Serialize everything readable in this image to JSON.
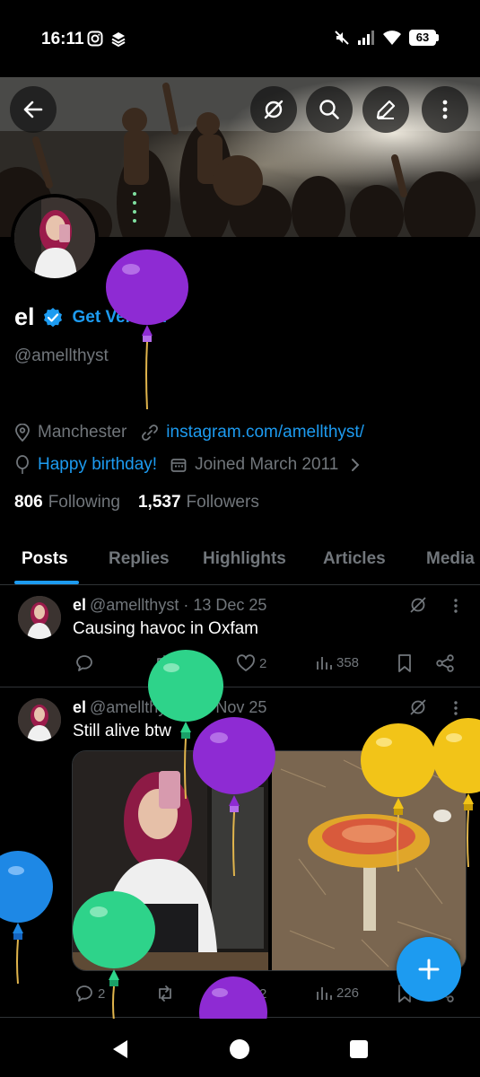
{
  "status_bar": {
    "time": "16:11",
    "battery": "63"
  },
  "header_buttons": [
    "back-arrow-icon",
    "grok-icon",
    "search-icon",
    "edit-icon",
    "more-vertical-icon"
  ],
  "profile": {
    "name": "el",
    "get_verified": "Get Verified",
    "handle": "@amellthyst",
    "location": "Manchester",
    "website": "instagram.com/amellthyst/",
    "birthday": "Happy birthday!",
    "joined": "Joined March 2011",
    "following_count": "806",
    "following_label": "Following",
    "followers_count": "1,537",
    "followers_label": "Followers"
  },
  "tabs": [
    {
      "label": "Posts",
      "active": true
    },
    {
      "label": "Replies",
      "active": false
    },
    {
      "label": "Highlights",
      "active": false
    },
    {
      "label": "Articles",
      "active": false
    },
    {
      "label": "Media",
      "active": false
    }
  ],
  "posts": [
    {
      "name": "el",
      "handle": "@amellthyst",
      "date": "13 Dec 25",
      "text": "Causing havoc in Oxfam",
      "likes": "2",
      "views": "358"
    },
    {
      "name": "el",
      "handle": "@amellthyst",
      "date": "23 Nov 25",
      "text": "Still alive btw",
      "replies": "2",
      "likes": "2",
      "views": "226"
    }
  ],
  "colors": {
    "accent": "#1d9bf0",
    "background": "#000000",
    "secondary_text": "#71767b",
    "balloon_purple": "#8e2bd3",
    "balloon_green": "#2ed38a",
    "balloon_yellow": "#f2c418",
    "balloon_blue": "#1e88e5"
  }
}
